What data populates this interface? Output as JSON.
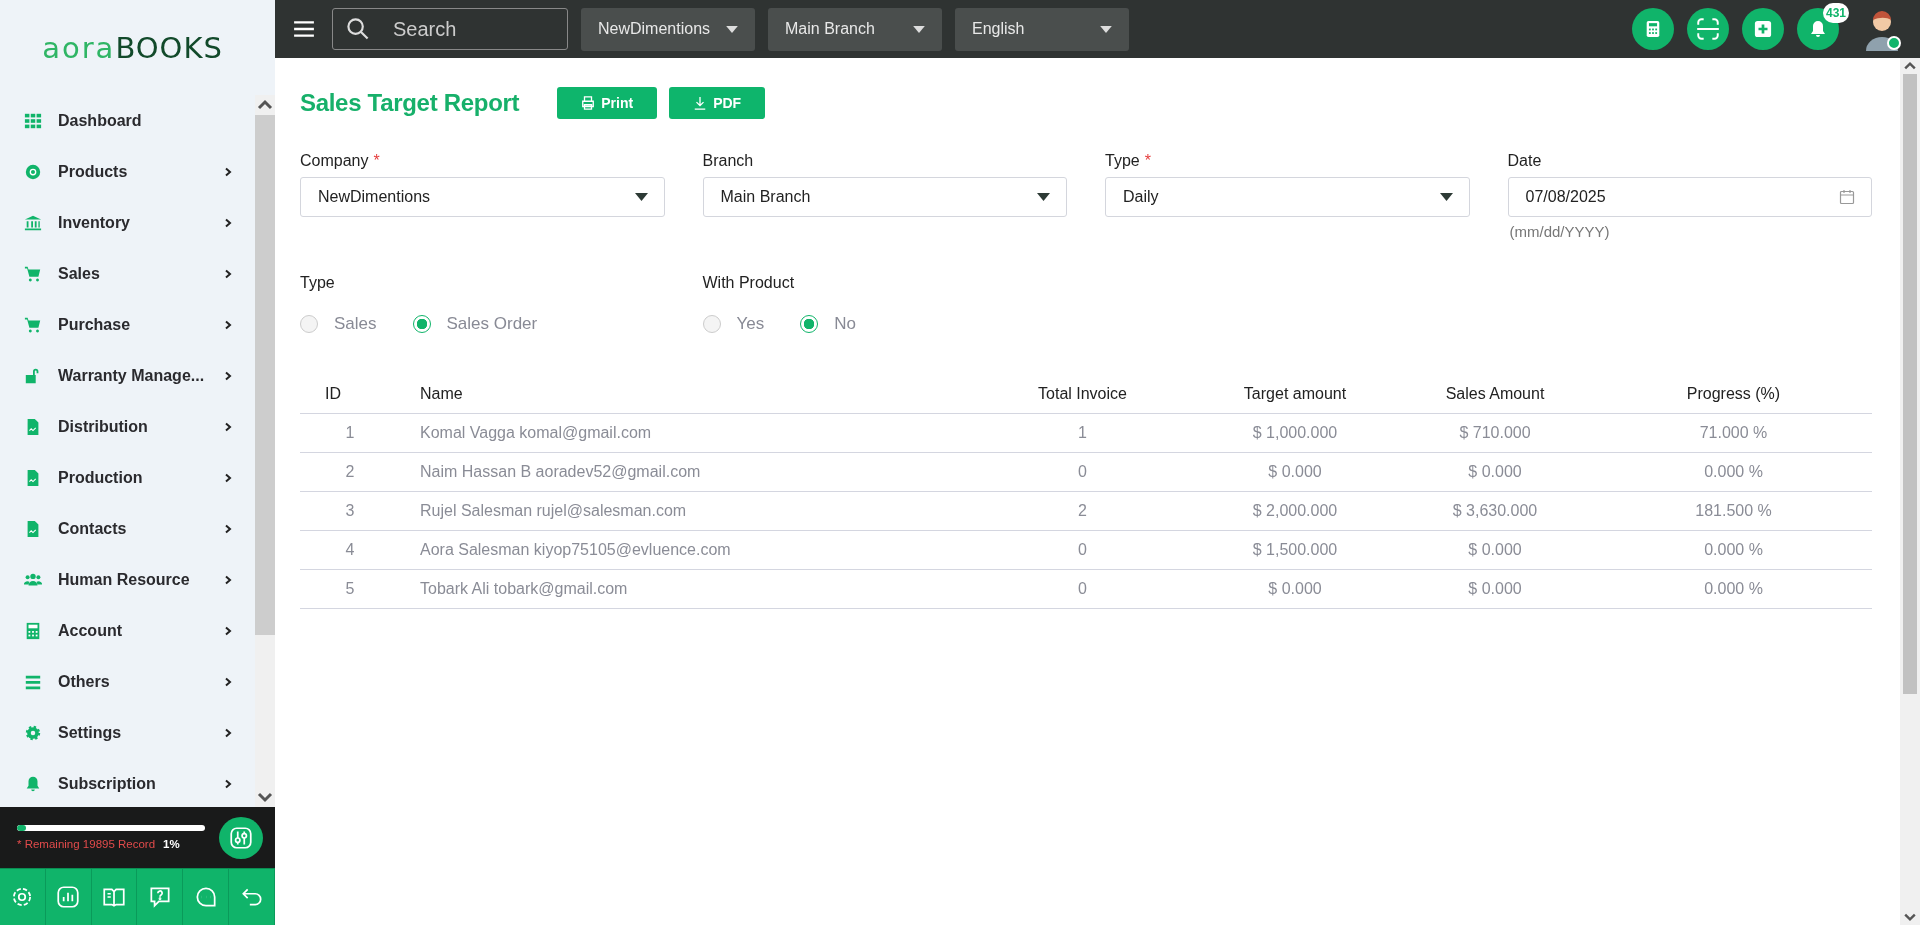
{
  "logo": {
    "light": "aora",
    "dark": "BOOKS"
  },
  "sidebar": {
    "items": [
      {
        "label": "Dashboard",
        "has_submenu": false
      },
      {
        "label": "Products",
        "has_submenu": true
      },
      {
        "label": "Inventory",
        "has_submenu": true
      },
      {
        "label": "Sales",
        "has_submenu": true
      },
      {
        "label": "Purchase",
        "has_submenu": true
      },
      {
        "label": "Warranty Manage...",
        "has_submenu": true
      },
      {
        "label": "Distribution",
        "has_submenu": true
      },
      {
        "label": "Production",
        "has_submenu": true
      },
      {
        "label": "Contacts",
        "has_submenu": true
      },
      {
        "label": "Human Resource",
        "has_submenu": true
      },
      {
        "label": "Account",
        "has_submenu": true
      },
      {
        "label": "Others",
        "has_submenu": true
      },
      {
        "label": "Settings",
        "has_submenu": true
      },
      {
        "label": "Subscription",
        "has_submenu": true
      }
    ],
    "usage": {
      "level": 0.05,
      "remaining": "* Remaining 19895 Record",
      "percent": "1%"
    }
  },
  "topbar": {
    "search": {
      "placeholder": "Search"
    },
    "selectors": [
      "NewDimentions",
      "Main Branch",
      "English"
    ],
    "notification_count": "431"
  },
  "page": {
    "title": "Sales Target Report",
    "buttons": [
      "Print",
      "PDF"
    ],
    "fields": [
      {
        "label": "Company",
        "required_mark": "*",
        "value": "NewDimentions",
        "kind": "select"
      },
      {
        "label": "Branch",
        "value": "Main Branch",
        "kind": "select"
      },
      {
        "label": "Type",
        "required_mark": "*",
        "value": "Daily",
        "kind": "select"
      },
      {
        "label": "Date",
        "value": "07/08/2025",
        "kind": "date",
        "hint": "(mm/dd/YYYY)"
      }
    ],
    "radio_groups": [
      {
        "label": "Type",
        "options": [
          {
            "label": "Sales",
            "selected": false
          },
          {
            "label": "Sales Order",
            "selected": true
          }
        ]
      },
      {
        "label": "With Product",
        "options": [
          {
            "label": "Yes",
            "selected": false
          },
          {
            "label": "No",
            "selected": true
          }
        ]
      }
    ]
  },
  "table": {
    "columns": [
      "ID",
      "Name",
      "Total Invoice",
      "Target amount",
      "Sales Amount",
      "Progress (%)"
    ],
    "rows": [
      [
        "1",
        "Komal Vagga komal@gmail.com",
        "1",
        "$ 1,000.000",
        "$ 710.000",
        "71.000 %"
      ],
      [
        "2",
        "Naim Hassan B aoradev52@gmail.com",
        "0",
        "$ 0.000",
        "$ 0.000",
        "0.000 %"
      ],
      [
        "3",
        "Rujel Salesman rujel@salesman.com",
        "2",
        "$ 2,000.000",
        "$ 3,630.000",
        "181.500 %"
      ],
      [
        "4",
        "Aora Salesman kiyop75105@evluence.com",
        "0",
        "$ 1,500.000",
        "$ 0.000",
        "0.000 %"
      ],
      [
        "5",
        "Tobark Ali tobark@gmail.com",
        "0",
        "$ 0.000",
        "$ 0.000",
        "0.000 %"
      ]
    ]
  }
}
